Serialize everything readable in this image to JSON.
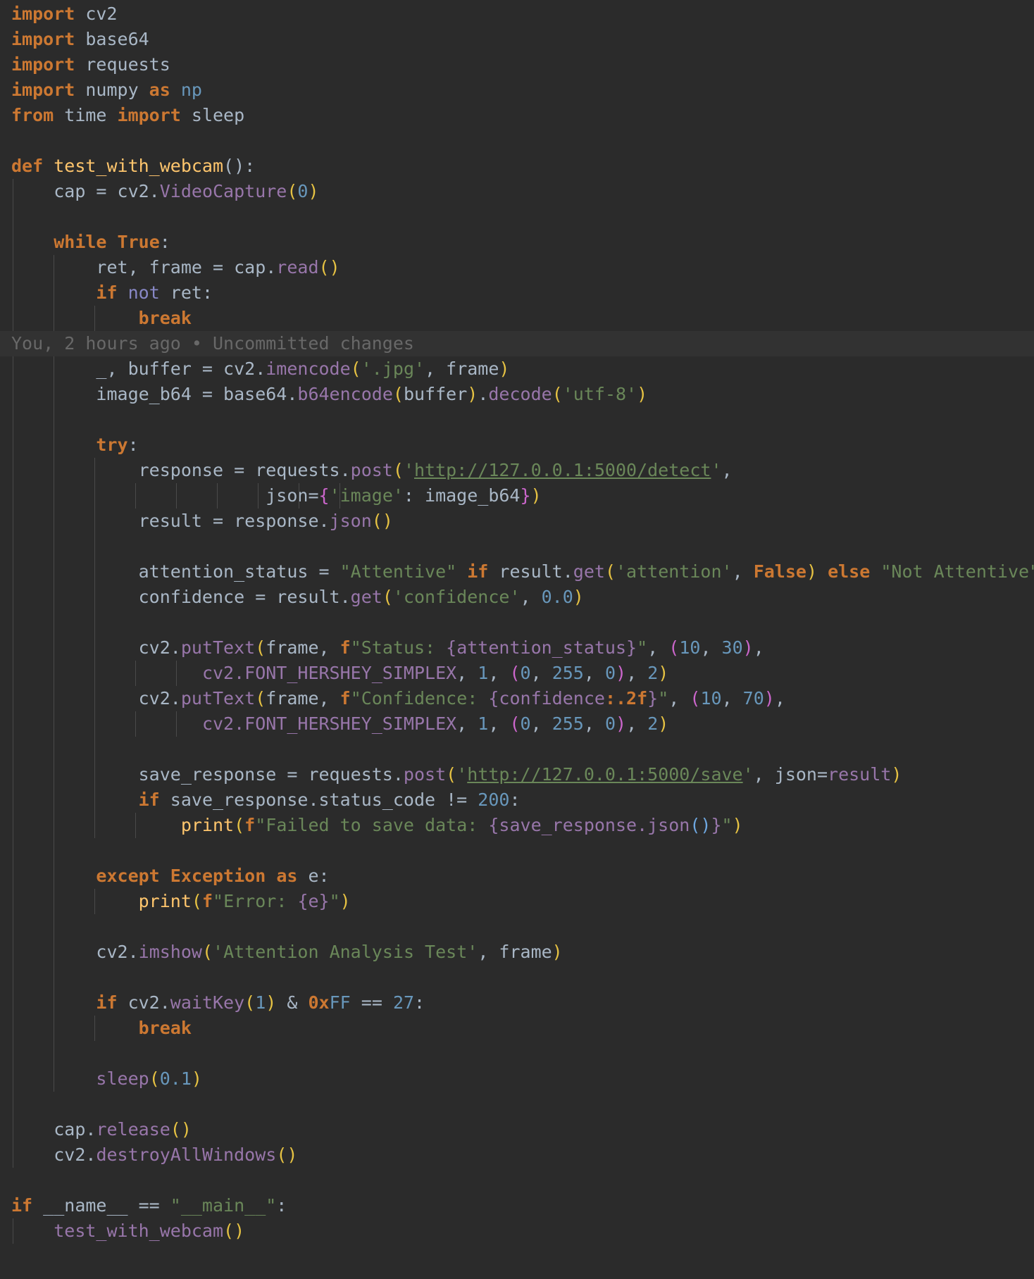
{
  "blame": {
    "text": "You, 2 hours ago • Uncommitted changes"
  },
  "code_lines": [
    {
      "indent": 0,
      "guides": [],
      "tokens": [
        {
          "t": "import",
          "c": "kw"
        },
        {
          "t": " cv2"
        }
      ]
    },
    {
      "indent": 0,
      "guides": [],
      "tokens": [
        {
          "t": "import",
          "c": "kw"
        },
        {
          "t": " base64"
        }
      ]
    },
    {
      "indent": 0,
      "guides": [],
      "tokens": [
        {
          "t": "import",
          "c": "kw"
        },
        {
          "t": " requests"
        }
      ]
    },
    {
      "indent": 0,
      "guides": [],
      "tokens": [
        {
          "t": "import",
          "c": "kw"
        },
        {
          "t": " numpy "
        },
        {
          "t": "as",
          "c": "kw"
        },
        {
          "t": " np",
          "c": "num"
        }
      ]
    },
    {
      "indent": 0,
      "guides": [],
      "tokens": [
        {
          "t": "from",
          "c": "kw"
        },
        {
          "t": " time "
        },
        {
          "t": "import",
          "c": "kw"
        },
        {
          "t": " sleep"
        }
      ]
    },
    {
      "indent": 0,
      "guides": [],
      "tokens": []
    },
    {
      "indent": 0,
      "guides": [],
      "tokens": [
        {
          "t": "def",
          "c": "kw"
        },
        {
          "t": " "
        },
        {
          "t": "test_with_webcam",
          "c": "fn"
        },
        {
          "t": "():"
        }
      ]
    },
    {
      "indent": 1,
      "guides": [
        0
      ],
      "tokens": [
        {
          "t": "cap = cv2."
        },
        {
          "t": "VideoCapture",
          "c": "mth"
        },
        {
          "t": "(",
          "c": "p1"
        },
        {
          "t": "0",
          "c": "num"
        },
        {
          "t": ")",
          "c": "p1"
        }
      ]
    },
    {
      "indent": 1,
      "guides": [
        0
      ],
      "tokens": []
    },
    {
      "indent": 1,
      "guides": [
        0
      ],
      "tokens": [
        {
          "t": "while",
          "c": "kw"
        },
        {
          "t": " "
        },
        {
          "t": "True",
          "c": "kw"
        },
        {
          "t": ":"
        }
      ]
    },
    {
      "indent": 2,
      "guides": [
        0,
        1
      ],
      "tokens": [
        {
          "t": "ret, frame = cap."
        },
        {
          "t": "read",
          "c": "mth"
        },
        {
          "t": "()",
          "c": "p1"
        }
      ]
    },
    {
      "indent": 2,
      "guides": [
        0,
        1
      ],
      "tokens": [
        {
          "t": "if",
          "c": "kw"
        },
        {
          "t": " "
        },
        {
          "t": "not",
          "c": "bi"
        },
        {
          "t": " ret:"
        }
      ]
    },
    {
      "indent": 3,
      "guides": [
        0,
        1,
        2
      ],
      "tokens": [
        {
          "t": "break",
          "c": "kw"
        }
      ]
    },
    {
      "indent": 0,
      "guides": [],
      "blame": true,
      "tokens": [
        {
          "t": "  You, 2 hours ago • Uncommitted changes",
          "c": "blame",
          "bind": "blame.text"
        }
      ]
    },
    {
      "indent": 2,
      "guides": [
        0,
        1
      ],
      "tokens": [
        {
          "t": "_, buffer = cv2."
        },
        {
          "t": "imencode",
          "c": "mth"
        },
        {
          "t": "(",
          "c": "p1"
        },
        {
          "t": "'.jpg'",
          "c": "str"
        },
        {
          "t": ", frame"
        },
        {
          "t": ")",
          "c": "p1"
        }
      ]
    },
    {
      "indent": 2,
      "guides": [
        0,
        1
      ],
      "tokens": [
        {
          "t": "image_b64 = base64."
        },
        {
          "t": "b64encode",
          "c": "mth"
        },
        {
          "t": "(",
          "c": "p1"
        },
        {
          "t": "buffer"
        },
        {
          "t": ")",
          "c": "p1"
        },
        {
          "t": "."
        },
        {
          "t": "decode",
          "c": "mth"
        },
        {
          "t": "(",
          "c": "p1"
        },
        {
          "t": "'utf-8'",
          "c": "str"
        },
        {
          "t": ")",
          "c": "p1"
        }
      ]
    },
    {
      "indent": 2,
      "guides": [
        0,
        1
      ],
      "tokens": []
    },
    {
      "indent": 2,
      "guides": [
        0,
        1
      ],
      "tokens": [
        {
          "t": "try",
          "c": "kw"
        },
        {
          "t": ":"
        }
      ]
    },
    {
      "indent": 3,
      "guides": [
        0,
        1,
        2
      ],
      "tokens": [
        {
          "t": "response = requests."
        },
        {
          "t": "post",
          "c": "mth"
        },
        {
          "t": "(",
          "c": "p1"
        },
        {
          "t": "'",
          "c": "str"
        },
        {
          "t": "http://127.0.0.1:5000/detect",
          "c": "str lnk"
        },
        {
          "t": "'",
          "c": "str"
        },
        {
          "t": ","
        }
      ]
    },
    {
      "indent": 3,
      "guides": [
        0,
        1,
        2,
        3,
        4,
        5,
        6,
        7,
        8
      ],
      "extra": "            ",
      "tokens": [
        {
          "t": "json="
        },
        {
          "t": "{",
          "c": "p2"
        },
        {
          "t": "'image'",
          "c": "str"
        },
        {
          "t": ": image_b64"
        },
        {
          "t": "}",
          "c": "p2"
        },
        {
          "t": ")",
          "c": "p1"
        }
      ]
    },
    {
      "indent": 3,
      "guides": [
        0,
        1,
        2
      ],
      "tokens": [
        {
          "t": "result = response."
        },
        {
          "t": "json",
          "c": "mth"
        },
        {
          "t": "()",
          "c": "p1"
        }
      ]
    },
    {
      "indent": 3,
      "guides": [
        0,
        1,
        2
      ],
      "tokens": []
    },
    {
      "indent": 3,
      "guides": [
        0,
        1,
        2
      ],
      "tokens": [
        {
          "t": "attention_status = "
        },
        {
          "t": "\"Attentive\"",
          "c": "str"
        },
        {
          "t": " "
        },
        {
          "t": "if",
          "c": "kw"
        },
        {
          "t": " result."
        },
        {
          "t": "get",
          "c": "mth"
        },
        {
          "t": "(",
          "c": "p1"
        },
        {
          "t": "'attention'",
          "c": "str"
        },
        {
          "t": ", "
        },
        {
          "t": "False",
          "c": "kw"
        },
        {
          "t": ")",
          "c": "p1"
        },
        {
          "t": " "
        },
        {
          "t": "else",
          "c": "kw"
        },
        {
          "t": " "
        },
        {
          "t": "\"Not Attentive\"",
          "c": "str"
        }
      ]
    },
    {
      "indent": 3,
      "guides": [
        0,
        1,
        2
      ],
      "tokens": [
        {
          "t": "confidence = result."
        },
        {
          "t": "get",
          "c": "mth"
        },
        {
          "t": "(",
          "c": "p1"
        },
        {
          "t": "'confidence'",
          "c": "str"
        },
        {
          "t": ", "
        },
        {
          "t": "0.0",
          "c": "num"
        },
        {
          "t": ")",
          "c": "p1"
        }
      ]
    },
    {
      "indent": 3,
      "guides": [
        0,
        1,
        2
      ],
      "tokens": []
    },
    {
      "indent": 3,
      "guides": [
        0,
        1,
        2
      ],
      "tokens": [
        {
          "t": "cv2."
        },
        {
          "t": "putText",
          "c": "mth"
        },
        {
          "t": "(",
          "c": "p1"
        },
        {
          "t": "frame, "
        },
        {
          "t": "f",
          "c": "kw"
        },
        {
          "t": "\"Status: ",
          "c": "str"
        },
        {
          "t": "{attention_status}",
          "c": "mth"
        },
        {
          "t": "\"",
          "c": "str"
        },
        {
          "t": ", "
        },
        {
          "t": "(",
          "c": "p2"
        },
        {
          "t": "10",
          "c": "num"
        },
        {
          "t": ", "
        },
        {
          "t": "30",
          "c": "num"
        },
        {
          "t": ")",
          "c": "p2"
        },
        {
          "t": ","
        }
      ]
    },
    {
      "indent": 3,
      "guides": [
        0,
        1,
        2,
        3,
        4
      ],
      "extra": "      ",
      "tokens": [
        {
          "t": "cv2.FONT_HERSHEY_SIMPLEX",
          "c": "mth"
        },
        {
          "t": ", "
        },
        {
          "t": "1",
          "c": "num"
        },
        {
          "t": ", "
        },
        {
          "t": "(",
          "c": "p2"
        },
        {
          "t": "0",
          "c": "num"
        },
        {
          "t": ", "
        },
        {
          "t": "255",
          "c": "num"
        },
        {
          "t": ", "
        },
        {
          "t": "0",
          "c": "num"
        },
        {
          "t": ")",
          "c": "p2"
        },
        {
          "t": ", "
        },
        {
          "t": "2",
          "c": "num"
        },
        {
          "t": ")",
          "c": "p1"
        }
      ]
    },
    {
      "indent": 3,
      "guides": [
        0,
        1,
        2
      ],
      "tokens": [
        {
          "t": "cv2."
        },
        {
          "t": "putText",
          "c": "mth"
        },
        {
          "t": "(",
          "c": "p1"
        },
        {
          "t": "frame, "
        },
        {
          "t": "f",
          "c": "kw"
        },
        {
          "t": "\"Confidence: ",
          "c": "str"
        },
        {
          "t": "{confidence",
          "c": "mth"
        },
        {
          "t": ":.2f",
          "c": "kw"
        },
        {
          "t": "}",
          "c": "mth"
        },
        {
          "t": "\"",
          "c": "str"
        },
        {
          "t": ", "
        },
        {
          "t": "(",
          "c": "p2"
        },
        {
          "t": "10",
          "c": "num"
        },
        {
          "t": ", "
        },
        {
          "t": "70",
          "c": "num"
        },
        {
          "t": ")",
          "c": "p2"
        },
        {
          "t": ","
        }
      ]
    },
    {
      "indent": 3,
      "guides": [
        0,
        1,
        2,
        3,
        4
      ],
      "extra": "      ",
      "tokens": [
        {
          "t": "cv2.FONT_HERSHEY_SIMPLEX",
          "c": "mth"
        },
        {
          "t": ", "
        },
        {
          "t": "1",
          "c": "num"
        },
        {
          "t": ", "
        },
        {
          "t": "(",
          "c": "p2"
        },
        {
          "t": "0",
          "c": "num"
        },
        {
          "t": ", "
        },
        {
          "t": "255",
          "c": "num"
        },
        {
          "t": ", "
        },
        {
          "t": "0",
          "c": "num"
        },
        {
          "t": ")",
          "c": "p2"
        },
        {
          "t": ", "
        },
        {
          "t": "2",
          "c": "num"
        },
        {
          "t": ")",
          "c": "p1"
        }
      ]
    },
    {
      "indent": 3,
      "guides": [
        0,
        1,
        2
      ],
      "tokens": []
    },
    {
      "indent": 3,
      "guides": [
        0,
        1,
        2
      ],
      "tokens": [
        {
          "t": "save_response = requests."
        },
        {
          "t": "post",
          "c": "mth"
        },
        {
          "t": "(",
          "c": "p1"
        },
        {
          "t": "'",
          "c": "str"
        },
        {
          "t": "http://127.0.0.1:5000/save",
          "c": "str lnk"
        },
        {
          "t": "'",
          "c": "str"
        },
        {
          "t": ", json="
        },
        {
          "t": "result",
          "c": "mth"
        },
        {
          "t": ")",
          "c": "p1"
        }
      ]
    },
    {
      "indent": 3,
      "guides": [
        0,
        1,
        2
      ],
      "tokens": [
        {
          "t": "if",
          "c": "kw"
        },
        {
          "t": " save_response.status_code != "
        },
        {
          "t": "200",
          "c": "num"
        },
        {
          "t": ":"
        }
      ]
    },
    {
      "indent": 4,
      "guides": [
        0,
        1,
        2,
        3
      ],
      "tokens": [
        {
          "t": "print",
          "c": "fn"
        },
        {
          "t": "(",
          "c": "p1"
        },
        {
          "t": "f",
          "c": "kw"
        },
        {
          "t": "\"Failed to save data: ",
          "c": "str"
        },
        {
          "t": "{save_response.json",
          "c": "mth"
        },
        {
          "t": "()",
          "c": "p3"
        },
        {
          "t": "}",
          "c": "mth"
        },
        {
          "t": "\"",
          "c": "str"
        },
        {
          "t": ")",
          "c": "p1"
        }
      ]
    },
    {
      "indent": 2,
      "guides": [
        0,
        1
      ],
      "tokens": []
    },
    {
      "indent": 2,
      "guides": [
        0,
        1
      ],
      "tokens": [
        {
          "t": "except",
          "c": "kw"
        },
        {
          "t": " "
        },
        {
          "t": "Exception",
          "c": "kw"
        },
        {
          "t": " "
        },
        {
          "t": "as",
          "c": "kw"
        },
        {
          "t": " e:"
        }
      ]
    },
    {
      "indent": 3,
      "guides": [
        0,
        1,
        2
      ],
      "tokens": [
        {
          "t": "print",
          "c": "fn"
        },
        {
          "t": "(",
          "c": "p1"
        },
        {
          "t": "f",
          "c": "kw"
        },
        {
          "t": "\"Error: ",
          "c": "str"
        },
        {
          "t": "{e}",
          "c": "mth"
        },
        {
          "t": "\"",
          "c": "str"
        },
        {
          "t": ")",
          "c": "p1"
        }
      ]
    },
    {
      "indent": 2,
      "guides": [
        0,
        1
      ],
      "tokens": []
    },
    {
      "indent": 2,
      "guides": [
        0,
        1
      ],
      "tokens": [
        {
          "t": "cv2."
        },
        {
          "t": "imshow",
          "c": "mth"
        },
        {
          "t": "(",
          "c": "p1"
        },
        {
          "t": "'Attention Analysis Test'",
          "c": "str"
        },
        {
          "t": ", frame"
        },
        {
          "t": ")",
          "c": "p1"
        }
      ]
    },
    {
      "indent": 2,
      "guides": [
        0,
        1
      ],
      "tokens": []
    },
    {
      "indent": 2,
      "guides": [
        0,
        1
      ],
      "tokens": [
        {
          "t": "if",
          "c": "kw"
        },
        {
          "t": " cv2."
        },
        {
          "t": "waitKey",
          "c": "mth"
        },
        {
          "t": "(",
          "c": "p1"
        },
        {
          "t": "1",
          "c": "num"
        },
        {
          "t": ")",
          "c": "p1"
        },
        {
          "t": " & "
        },
        {
          "t": "0x",
          "c": "kw"
        },
        {
          "t": "FF",
          "c": "num"
        },
        {
          "t": " == "
        },
        {
          "t": "27",
          "c": "num"
        },
        {
          "t": ":"
        }
      ]
    },
    {
      "indent": 3,
      "guides": [
        0,
        1,
        2
      ],
      "tokens": [
        {
          "t": "break",
          "c": "kw"
        }
      ]
    },
    {
      "indent": 2,
      "guides": [
        0,
        1
      ],
      "tokens": []
    },
    {
      "indent": 2,
      "guides": [
        0,
        1
      ],
      "tokens": [
        {
          "t": "sleep",
          "c": "mth"
        },
        {
          "t": "(",
          "c": "p1"
        },
        {
          "t": "0.1",
          "c": "num"
        },
        {
          "t": ")",
          "c": "p1"
        }
      ]
    },
    {
      "indent": 1,
      "guides": [
        0
      ],
      "tokens": []
    },
    {
      "indent": 1,
      "guides": [
        0
      ],
      "tokens": [
        {
          "t": "cap."
        },
        {
          "t": "release",
          "c": "mth"
        },
        {
          "t": "()",
          "c": "p1"
        }
      ]
    },
    {
      "indent": 1,
      "guides": [
        0
      ],
      "tokens": [
        {
          "t": "cv2."
        },
        {
          "t": "destroyAllWindows",
          "c": "mth"
        },
        {
          "t": "()",
          "c": "p1"
        }
      ]
    },
    {
      "indent": 0,
      "guides": [],
      "tokens": []
    },
    {
      "indent": 0,
      "guides": [],
      "tokens": [
        {
          "t": "if",
          "c": "kw"
        },
        {
          "t": " __name__ == "
        },
        {
          "t": "\"__main__\"",
          "c": "str"
        },
        {
          "t": ":"
        }
      ]
    },
    {
      "indent": 1,
      "guides": [
        0
      ],
      "tokens": [
        {
          "t": "test_with_webcam",
          "c": "mth"
        },
        {
          "t": "()",
          "c": "p1"
        }
      ]
    }
  ]
}
